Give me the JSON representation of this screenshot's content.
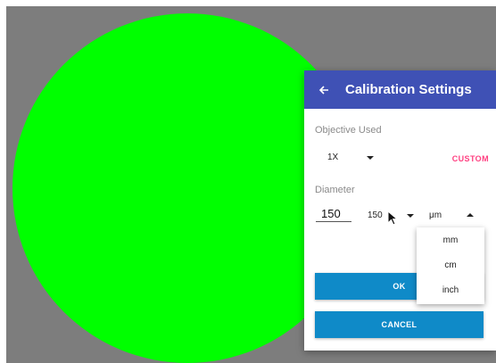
{
  "dialog": {
    "title": "Calibration Settings",
    "objective": {
      "label": "Objective Used",
      "selected": "1X",
      "custom_label": "CUSTOM"
    },
    "diameter": {
      "label": "Diameter",
      "input_value": "150",
      "select_value": "150",
      "unit_selected": "μm"
    },
    "ok_label": "OK",
    "cancel_label": "CANCEL"
  },
  "unit_menu": {
    "options": [
      "mm",
      "cm",
      "inch"
    ]
  },
  "colors": {
    "header": "#3f51b5",
    "accent_pink": "#ff4081",
    "button_blue": "#0f8ac8",
    "circle_green": "#00ff00",
    "background_gray": "#7d7d7d"
  },
  "icons": [
    "back-arrow-icon",
    "caret-down-icon",
    "caret-up-icon",
    "mouse-pointer-icon"
  ]
}
